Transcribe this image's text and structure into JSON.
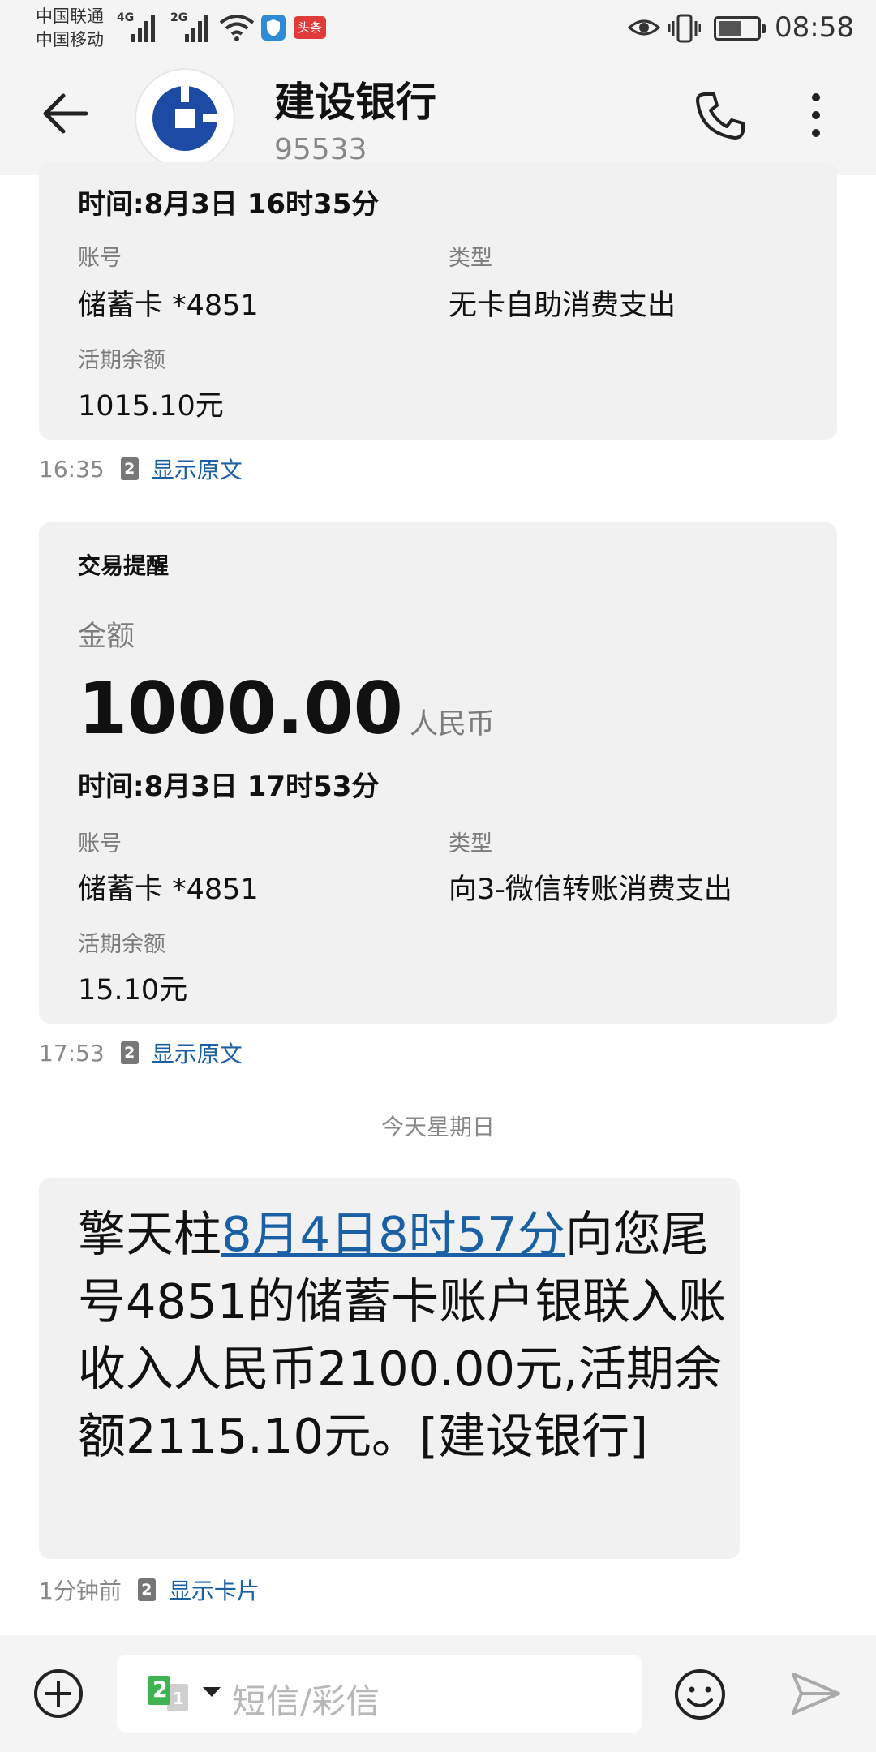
{
  "status_bar": {
    "carrier_1": "中国联通",
    "carrier_2": "中国移动",
    "net_1": "4G",
    "net_2": "2G",
    "toutiao": "头条",
    "time": "08:58"
  },
  "header": {
    "title": "建设银行",
    "number": "95533"
  },
  "messages": [
    {
      "time_line": "时间:8月3日 16时35分",
      "account_label": "账号",
      "account_value": "储蓄卡 *4851",
      "type_label": "类型",
      "type_value": "无卡自助消费支出",
      "balance_label": "活期余额",
      "balance_value": "1015.10元",
      "timestamp": "16:35",
      "sim": "2",
      "action": "显示原文"
    },
    {
      "heading": "交易提醒",
      "amount_label": "金额",
      "amount_value": "1000.00",
      "currency": "人民币",
      "time_line": "时间:8月3日 17时53分",
      "account_label": "账号",
      "account_value": "储蓄卡 *4851",
      "type_label": "类型",
      "type_value": "向3-微信转账消费支出",
      "balance_label": "活期余额",
      "balance_value": "15.10元",
      "timestamp": "17:53",
      "sim": "2",
      "action": "显示原文"
    }
  ],
  "day_separator": "今天星期日",
  "latest_message": {
    "text_before": "擎天柱",
    "text_link": "8月4日8时57分",
    "text_after": "向您尾号4851的储蓄卡账户银联入账收入人民币2100.00元,活期余额2115.10元。[建设银行]",
    "timestamp": "1分钟前",
    "sim": "2",
    "action": "显示卡片"
  },
  "composer": {
    "sim_primary": "2",
    "sim_secondary": "1",
    "placeholder": "短信/彩信"
  },
  "colors": {
    "link": "#1b5fa5",
    "bank_blue": "#1d4aa3",
    "bubble_bg": "#f1f1f1",
    "sim_green": "#3fb34f"
  }
}
